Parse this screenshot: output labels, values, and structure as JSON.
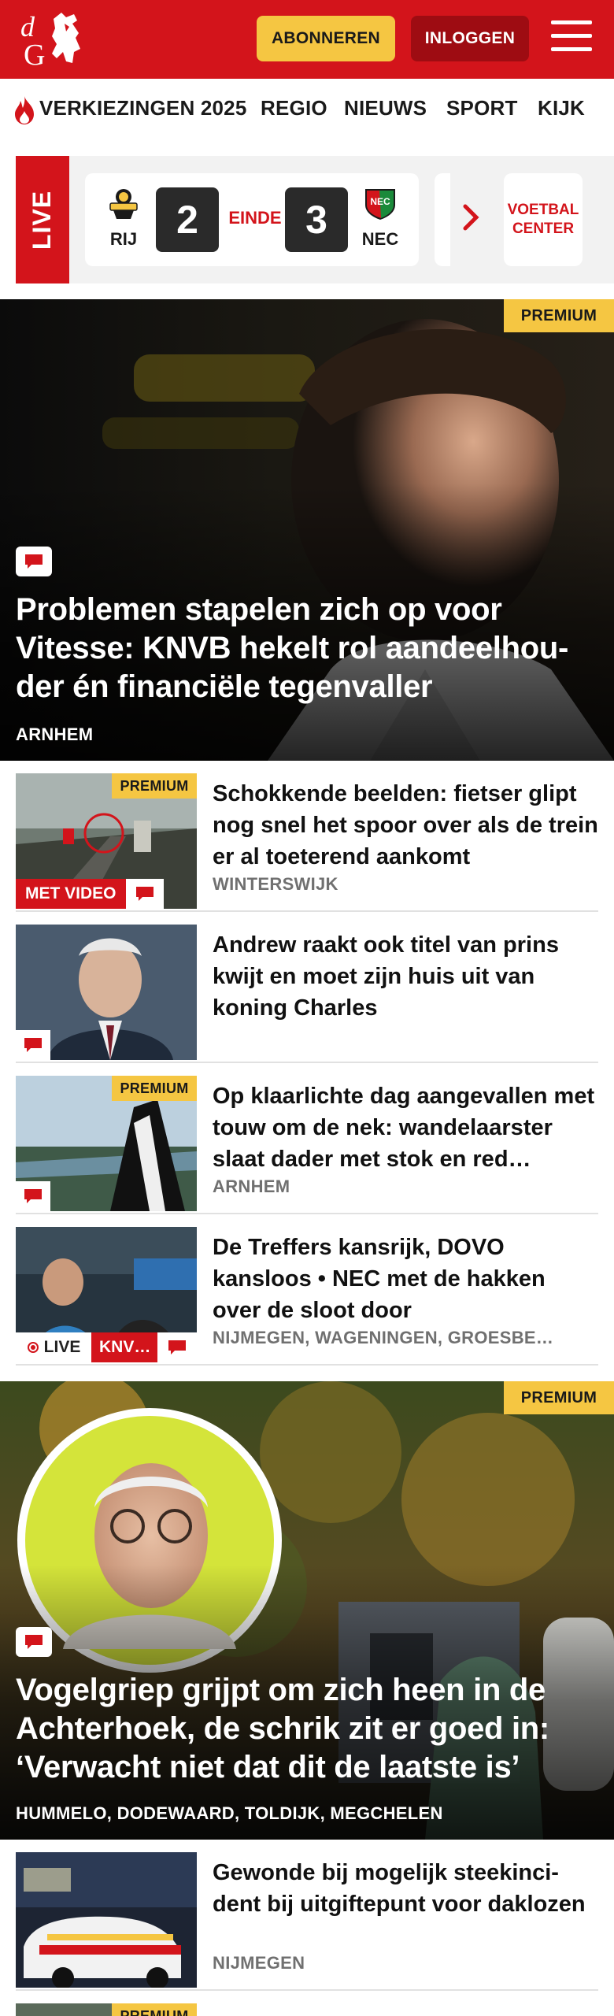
{
  "header": {
    "logo_text": "dG",
    "subscribe_label": "ABONNEREN",
    "login_label": "INLOGGEN",
    "brand_color": "#d3141b",
    "accent_color": "#f5c642"
  },
  "nav": {
    "items": [
      "VERKIEZINGEN 2025",
      "REGIO",
      "NIEUWS",
      "SPORT",
      "KIJK"
    ]
  },
  "live": {
    "label": "LIVE",
    "home_team": "RIJ",
    "home_score": "2",
    "status": "EINDE",
    "away_score": "3",
    "away_team": "NEC",
    "center_label": "VOETBAL CENTER"
  },
  "hero1": {
    "premium_label": "PREMIUM",
    "title": "Problemen stapelen zich op voor Vitesse: KNVB hekelt rol aandeelhou­der én financiële tegenvaller",
    "location": "ARNHEM"
  },
  "articles": [
    {
      "title": "Schokkende beelden: fietser glipt nog snel het spoor over als de trein er al toeterend aankomt",
      "location": "WINTERSWIJK",
      "premium_label": "PREMIUM",
      "video_label": "MET VIDEO"
    },
    {
      "title": "Andrew raakt ook titel van prins kwijt en moet zijn huis uit van koning Charles",
      "location": ""
    },
    {
      "title": "Op klaarlichte dag aangevallen met touw om de nek: wandelaar­ster slaat dader met stok en red…",
      "location": "ARNHEM",
      "premium_label": "PREMIUM"
    },
    {
      "title": "De Treffers kansrijk, DOVO kansloos • NEC met de hakken over de sloot door",
      "location": "NIJMEGEN, WAGENINGEN, GROESBE…",
      "live_label": "LIVE",
      "knvb_label": "KNV…"
    }
  ],
  "hero2": {
    "premium_label": "PREMIUM",
    "title": "Vogelgriep grijpt om zich heen in de Achterhoek, de schrik zit er goed in: ‘Verwacht niet dat dit de laatste is’",
    "location": "HUMMELO, DODEWAARD, TOLDIJK, MEGCHELEN"
  },
  "articles2": [
    {
      "title": "Gewonde bij mogelijk steekinci­dent bij uitgiftepunt voor daklozen",
      "location": "NIJMEGEN"
    },
    {
      "premium_label": "PREMIUM"
    }
  ]
}
